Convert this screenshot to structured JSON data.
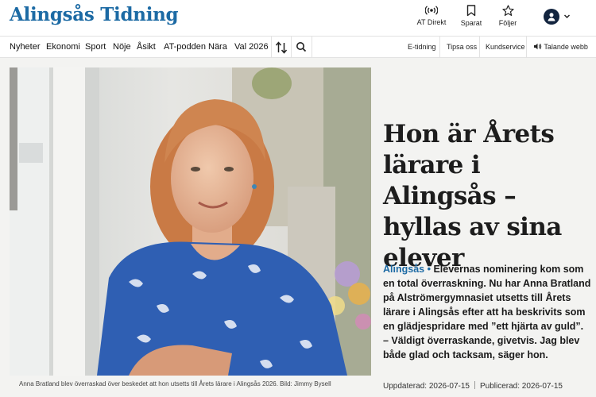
{
  "header": {
    "logo": "Alingsås Tidning",
    "actions": [
      {
        "label": "AT Direkt",
        "icon": "broadcast-icon"
      },
      {
        "label": "Sparat",
        "icon": "bookmark-icon"
      },
      {
        "label": "Följer",
        "icon": "star-icon"
      }
    ],
    "account_icon": "user-icon"
  },
  "nav": {
    "items": [
      "Nyheter",
      "Ekonomi",
      "Sport",
      "Nöje",
      "Åsikt",
      "AT-podden",
      "Nära",
      "Val 2026"
    ],
    "sort_icon": "sort-icon",
    "search_icon": "search-icon",
    "utility": [
      "E-tidning",
      "Tipsa oss",
      "Kundservice",
      "Talande webb"
    ],
    "speaker_icon": "speaker-icon"
  },
  "article": {
    "headline": "Hon är Årets lärare i Alingsås – hyllas av sina elever",
    "location": "Alingsås",
    "bullet": "•",
    "lead": "Elevernas nominering kom som en total överraskning. Nu har Anna Bratland på Alströmergymnasiet utsetts till Årets lärare i Alingsås efter att ha beskrivits som en glädjespridare med ”ett hjärta av guld”.",
    "quote": "– Väldigt överraskande, givetvis. Jag blev både glad och tacksam, säger hon.",
    "caption": "Anna Bratland blev överraskad över beskedet att hon utsetts till Årets lärare i Alingsås 2026. Bild: Jimmy Bysell",
    "updated": "Uppdaterad: 2026-07-15",
    "published": "Publicerad: 2026-07-15"
  },
  "colors": {
    "brand": "#1c6aa4",
    "account": "#13253f"
  }
}
